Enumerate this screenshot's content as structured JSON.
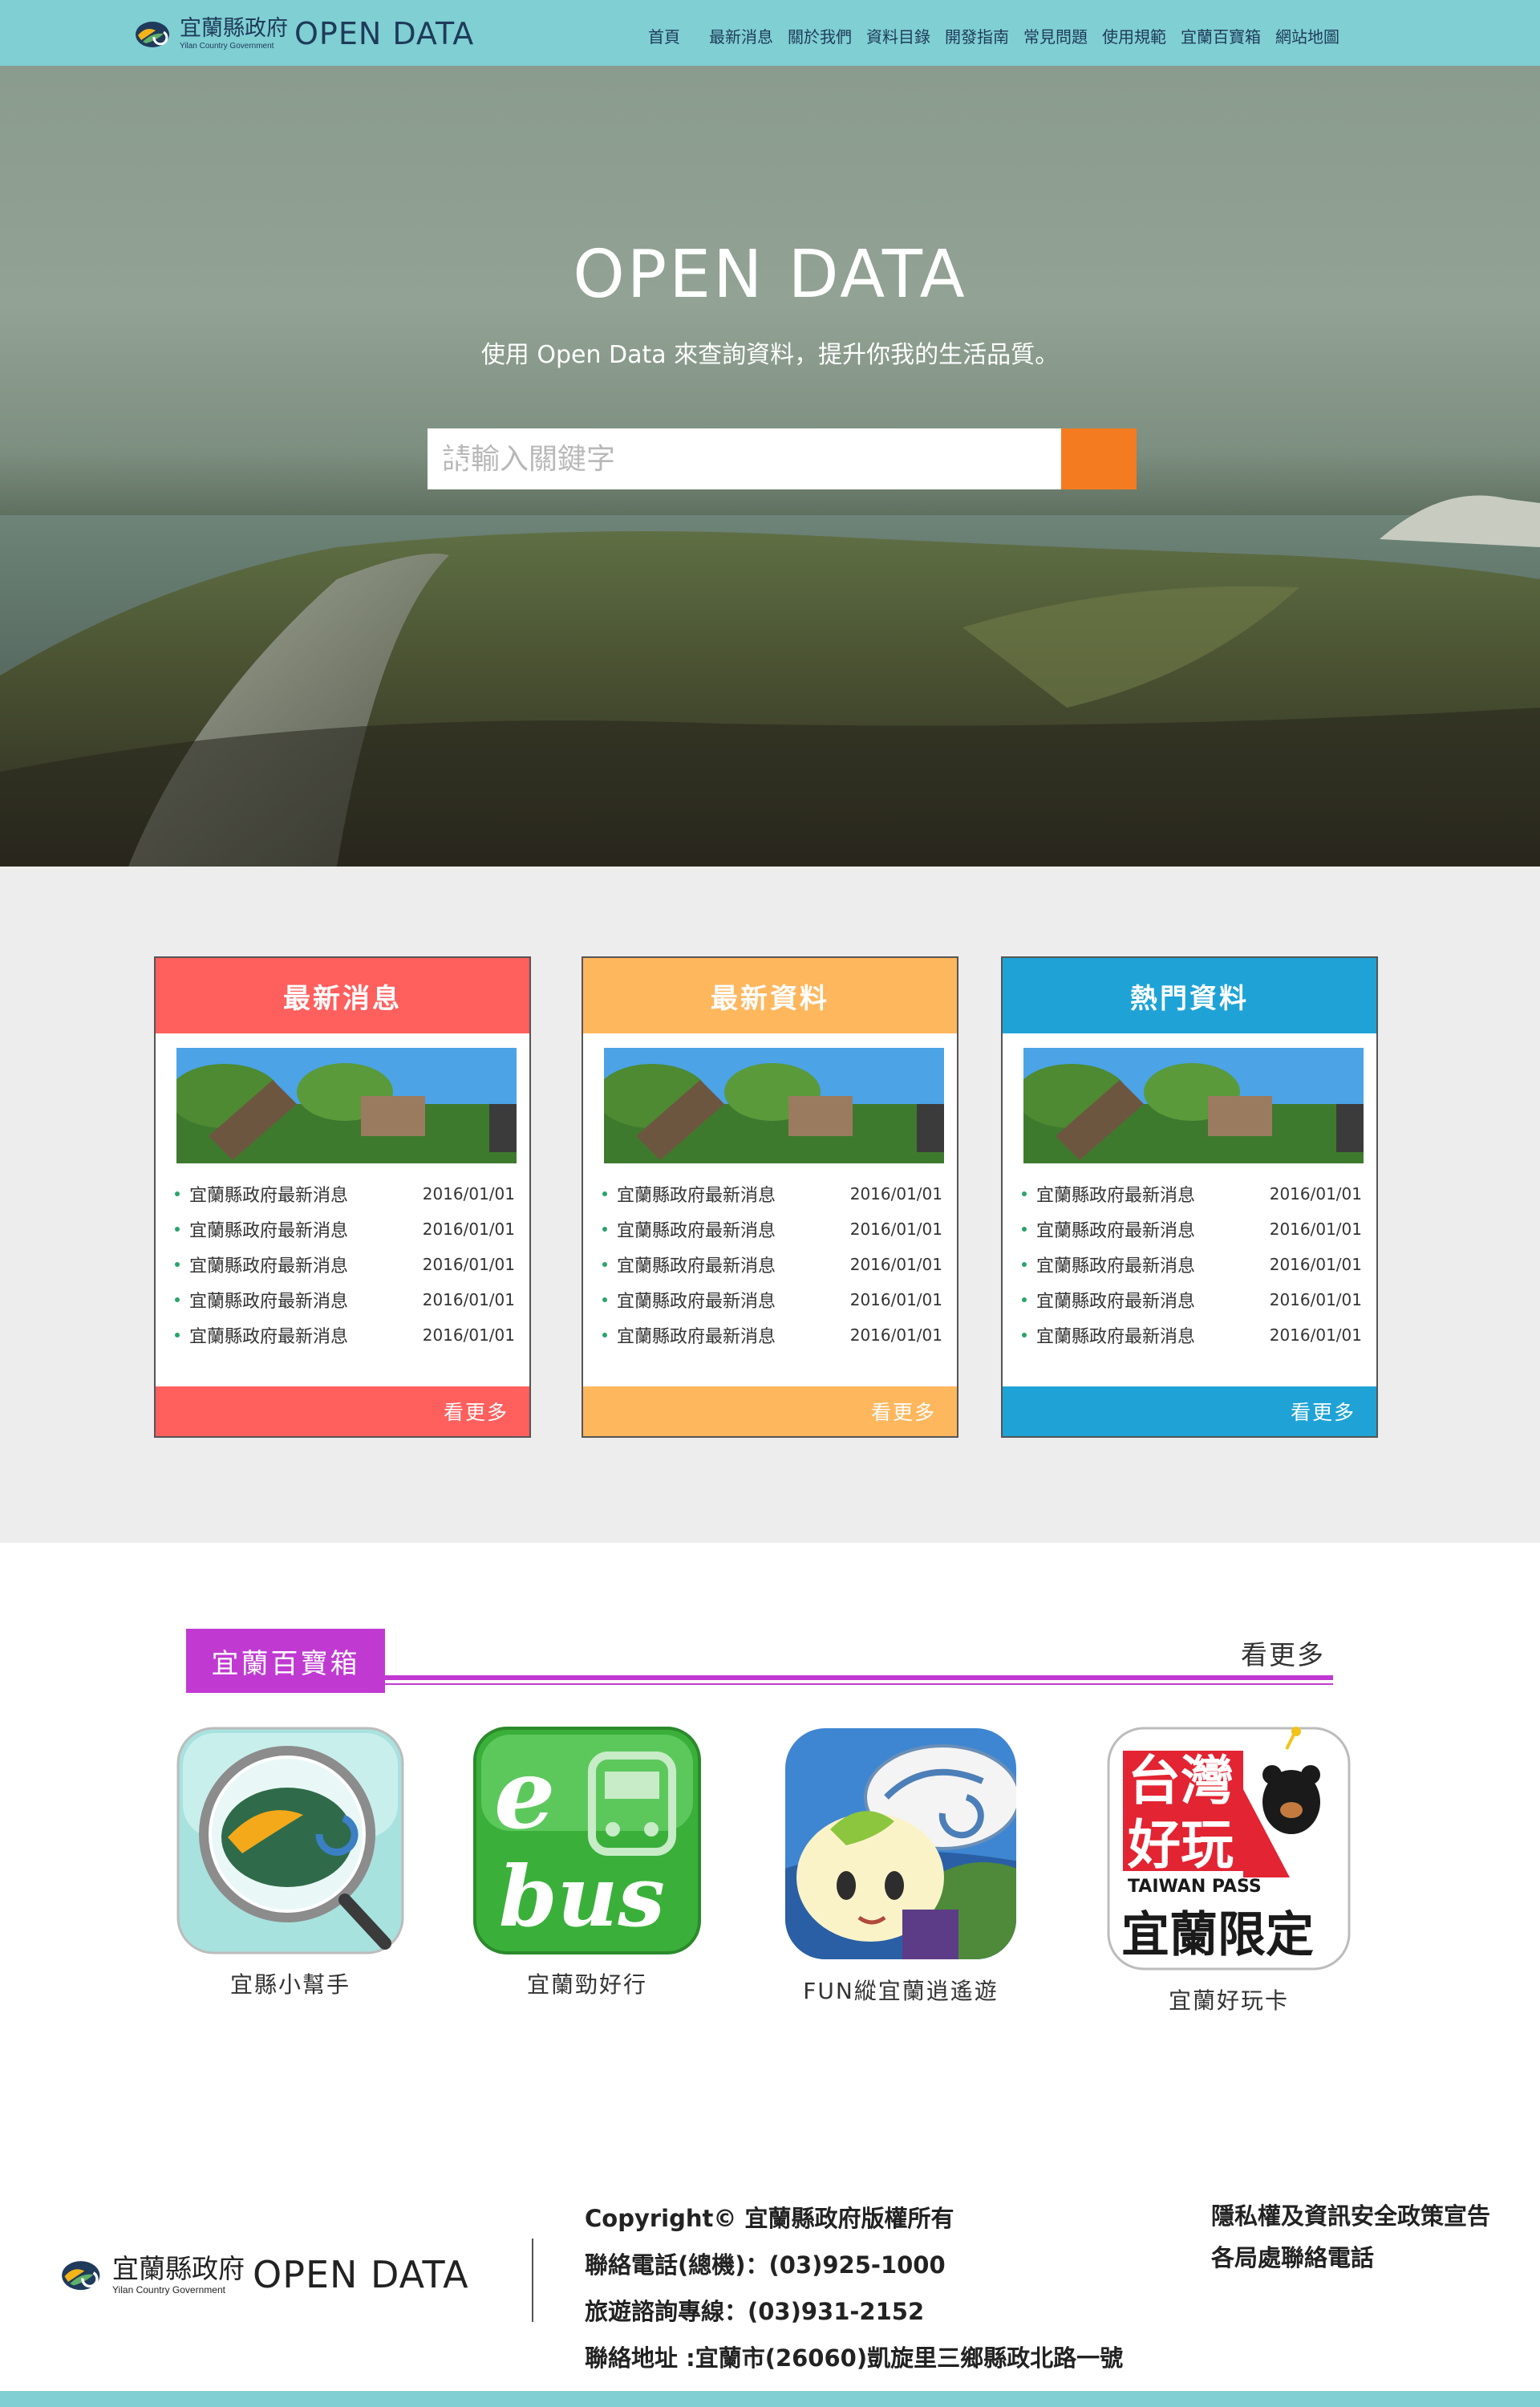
{
  "header": {
    "logo_cn": "宜蘭縣政府",
    "logo_en": "Yilan Country Government",
    "logo_od": "OPEN DATA",
    "nav": [
      "首頁",
      "最新消息",
      "關於我們",
      "資料目錄",
      "開發指南",
      "常見問題",
      "使用規範",
      "宜蘭百寶箱",
      "網站地圖"
    ]
  },
  "hero": {
    "title": "OPEN DATA",
    "subtitle": "使用 Open Data 來查詢資料，提升你我的生活品質。",
    "search_placeholder": "請輸入關鍵字"
  },
  "panels": [
    {
      "title": "最新消息",
      "color": "#ff5f5d",
      "items": [
        {
          "text": "宜蘭縣政府最新消息",
          "date": "2016/01/01"
        },
        {
          "text": "宜蘭縣政府最新消息",
          "date": "2016/01/01"
        },
        {
          "text": "宜蘭縣政府最新消息",
          "date": "2016/01/01"
        },
        {
          "text": "宜蘭縣政府最新消息",
          "date": "2016/01/01"
        },
        {
          "text": "宜蘭縣政府最新消息",
          "date": "2016/01/01"
        }
      ],
      "more": "看更多"
    },
    {
      "title": "最新資料",
      "color": "#ffb75e",
      "items": [
        {
          "text": "宜蘭縣政府最新消息",
          "date": "2016/01/01"
        },
        {
          "text": "宜蘭縣政府最新消息",
          "date": "2016/01/01"
        },
        {
          "text": "宜蘭縣政府最新消息",
          "date": "2016/01/01"
        },
        {
          "text": "宜蘭縣政府最新消息",
          "date": "2016/01/01"
        },
        {
          "text": "宜蘭縣政府最新消息",
          "date": "2016/01/01"
        }
      ],
      "more": "看更多"
    },
    {
      "title": "熱門資料",
      "color": "#1fa3d6",
      "items": [
        {
          "text": "宜蘭縣政府最新消息",
          "date": "2016/01/01"
        },
        {
          "text": "宜蘭縣政府最新消息",
          "date": "2016/01/01"
        },
        {
          "text": "宜蘭縣政府最新消息",
          "date": "2016/01/01"
        },
        {
          "text": "宜蘭縣政府最新消息",
          "date": "2016/01/01"
        },
        {
          "text": "宜蘭縣政府最新消息",
          "date": "2016/01/01"
        }
      ],
      "more": "看更多"
    }
  ],
  "apps": {
    "title": "宜蘭百寶箱",
    "more": "看更多",
    "accent": "#c03ad2",
    "items": [
      {
        "label": "宜縣小幫手",
        "icon": "magnifier-logo-icon"
      },
      {
        "label": "宜蘭勁好行",
        "icon": "ebus-icon",
        "icon_text_1": "e",
        "icon_text_2": "bus"
      },
      {
        "label": "FUN縱宜蘭逍遙遊",
        "icon": "mascot-icon"
      },
      {
        "label": "宜蘭好玩卡",
        "icon": "taiwan-pass-icon",
        "icon_text_1": "台灣",
        "icon_text_2": "好玩",
        "icon_text_3": "TAIWAN PASS",
        "icon_text_4": "宜蘭限定"
      }
    ]
  },
  "footer": {
    "logo_cn": "宜蘭縣政府",
    "logo_en": "Yilan Country Government",
    "logo_od": "OPEN DATA",
    "copyright": "Copyright© 宜蘭縣政府版權所有",
    "phone": "聯絡電話(總機)：(03)925-1000",
    "tour": "旅遊諮詢專線：(03)931-2152",
    "address": "聯絡地址 :宜蘭市(26060)凱旋里三鄉縣政北路一號",
    "links": [
      "隱私權及資訊安全政策宣告",
      "各局處聯絡電話"
    ]
  }
}
